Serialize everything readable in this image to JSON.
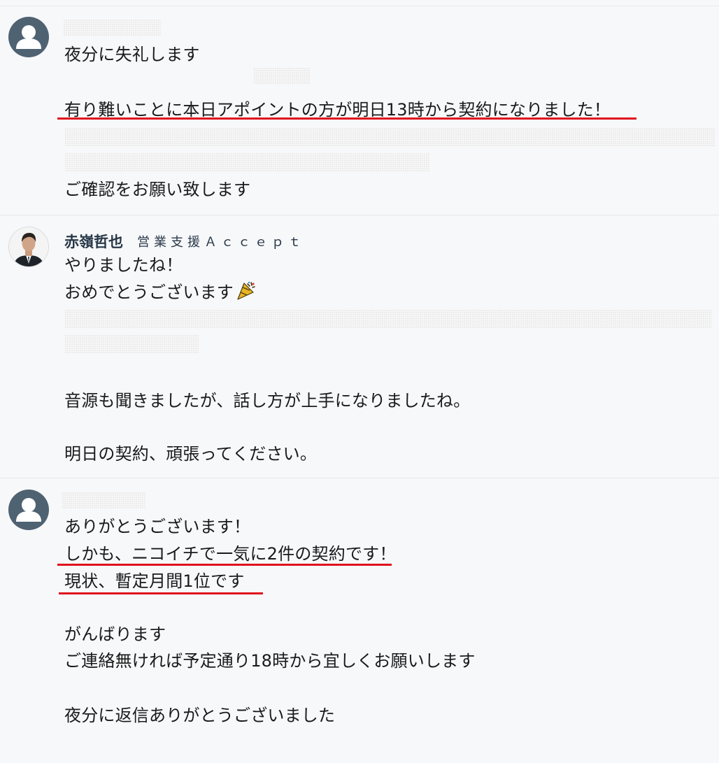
{
  "messages": [
    {
      "sender": {
        "avatar": "user-placeholder-icon",
        "name": "",
        "org": ""
      },
      "lines": [
        "夜分に失礼します",
        "有り難いことに本日アポイントの方が明日13時から契約になりました！",
        "ご確認をお願い致します"
      ]
    },
    {
      "sender": {
        "avatar": "profile-photo",
        "name": "赤嶺哲也",
        "org": "営業支援Ａｃｃｅｐｔ"
      },
      "lines": [
        "やりましたね！",
        "おめでとうございます",
        "音源も聞きましたが、話し方が上手になりましたね。",
        "明日の契約、頑張ってください。"
      ],
      "emoji": "party-popper-icon"
    },
    {
      "sender": {
        "avatar": "user-placeholder-icon",
        "name": "",
        "org": ""
      },
      "lines": [
        "ありがとうございます！",
        "しかも、ニコイチで一気に2件の契約です！",
        "現状、暫定月間1位です",
        "がんばります",
        "ご連絡無ければ予定通り18時から宜しくお願いします",
        "夜分に返信ありがとうございました"
      ]
    }
  ],
  "colors": {
    "highlight_underline": "#e0121c",
    "background": "#f7f8fa",
    "sender_name": "#283848",
    "avatar_placeholder": "#4f6272"
  }
}
